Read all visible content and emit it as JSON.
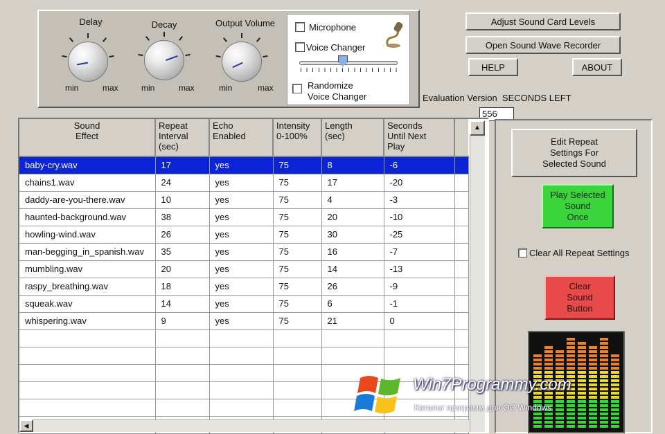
{
  "knobs": [
    {
      "label": "Delay",
      "min": "min",
      "max": "max"
    },
    {
      "label": "Decay",
      "min": "min",
      "max": "max"
    },
    {
      "label": "Output Volume",
      "min": "min",
      "max": "max"
    }
  ],
  "voice": {
    "microphone": "Microphone",
    "voice_changer": "Voice Changer",
    "randomize": "Randomize\nVoice Changer"
  },
  "buttons": {
    "adjust": "Adjust Sound Card Levels",
    "recorder": "Open Sound Wave Recorder",
    "help": "HELP",
    "about": "ABOUT",
    "edit_repeat": "Edit Repeat\nSettings For\nSelected Sound",
    "play_once": "Play Selected\nSound\nOnce",
    "clear_all": "Clear All Repeat Settings",
    "clear_sound": "Clear\nSound\nButton"
  },
  "eval": {
    "label": "Evaluation Version  SECONDS LEFT",
    "seconds": "556"
  },
  "table": {
    "headers": [
      "Sound\nEffect",
      "Repeat\nInterval\n(sec)",
      "Echo\nEnabled",
      "Intensity\n0-100%",
      "Length\n(sec)",
      "Seconds\nUntil Next\nPlay"
    ],
    "rows": [
      [
        "baby-cry.wav",
        "17",
        "yes",
        "75",
        "8",
        "-6"
      ],
      [
        "chains1.wav",
        "24",
        "yes",
        "75",
        "17",
        "-20"
      ],
      [
        "daddy-are-you-there.wav",
        "10",
        "yes",
        "75",
        "4",
        "-3"
      ],
      [
        "haunted-background.wav",
        "38",
        "yes",
        "75",
        "20",
        "-10"
      ],
      [
        "howling-wind.wav",
        "26",
        "yes",
        "75",
        "30",
        "-25"
      ],
      [
        "man-begging_in_spanish.wav",
        "35",
        "yes",
        "75",
        "16",
        "-7"
      ],
      [
        "mumbling.wav",
        "20",
        "yes",
        "75",
        "14",
        "-13"
      ],
      [
        "raspy_breathing.wav",
        "18",
        "yes",
        "75",
        "26",
        "-9"
      ],
      [
        "squeak.wav",
        "14",
        "yes",
        "75",
        "6",
        "-1"
      ],
      [
        "whispering.wav",
        "9",
        "yes",
        "75",
        "21",
        "0"
      ]
    ],
    "empty_rows": 6
  },
  "watermark": {
    "line1": "Win7Programmy.com",
    "line2": "Каталог программ для ОС Windows"
  }
}
